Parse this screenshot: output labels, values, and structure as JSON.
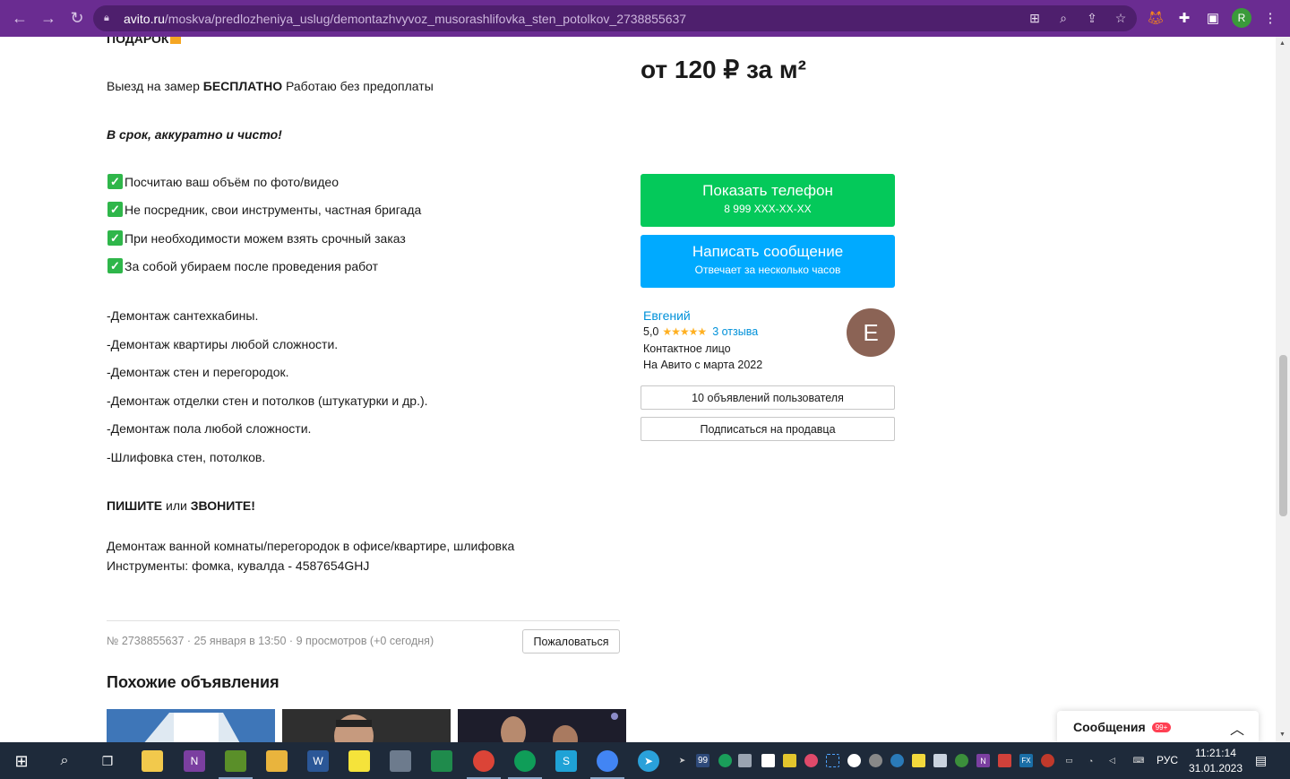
{
  "browser": {
    "url_host": "avito.ru",
    "url_path": "/moskva/predlozheniya_uslug/demontazhvyvoz_musorashlifovka_sten_potolkov_2738855637",
    "profile_initial": "R"
  },
  "description": {
    "gift_text": "ПОДАРОК",
    "visit_bold": "БЕСПЛАТНО",
    "visit_prefix": "Выезд на замер ",
    "visit_suffix": " Работаю без предоплаты",
    "slogan": "В срок, аккуратно и чисто!",
    "checks": [
      "Посчитаю ваш объём по фото/видео",
      "Не посредник, свои инструменты, частная бригада",
      "При необходимости можем взять срочный заказ",
      "За собой убираем после проведения работ"
    ],
    "services": [
      "-Демонтаж сантехкабины.",
      "-Демонтаж квартиры любой сложности.",
      "-Демонтаж стен и перегородок.",
      "-Демонтаж отделки стен и потолков (штукатурки и др.).",
      "-Демонтаж пола любой сложности.",
      "-Шлифовка стен, потолков."
    ],
    "cta_write": "ПИШИТЕ",
    "cta_or": " или ",
    "cta_call": "ЗВОНИТЕ!",
    "line1": "Демонтаж ванной комнаты/перегородок в офисе/квартире, шлифовка",
    "line2": "Инструменты: фомка, кувалда - 4587654GHJ"
  },
  "meta": {
    "info": "№ 2738855637 · 25 января в 13:50 · 9 просмотров (+0 сегодня)",
    "complain_label": "Пожаловаться"
  },
  "similar": {
    "title": "Похожие объявления"
  },
  "price": "от 120 ₽ за м²",
  "contact": {
    "phone_label": "Показать телефон",
    "phone_masked": "8 999 XXX-XX-XX",
    "message_label": "Написать сообщение",
    "message_sub": "Отвечает за несколько часов"
  },
  "seller": {
    "name": "Евгений",
    "rating": "5,0",
    "stars": "★★★★★",
    "reviews": "3 отзыва",
    "role": "Контактное лицо",
    "since": "На Авито с марта 2022",
    "avatar_initial": "Е",
    "listings_label": "10 объявлений пользователя",
    "subscribe_label": "Подписаться на продавца"
  },
  "messages": {
    "label": "Сообщения",
    "badge": "99+"
  },
  "taskbar": {
    "lang": "РУС",
    "time": "11:21:14",
    "date": "31.01.2023",
    "tray_badge": "99"
  },
  "colors": {
    "chrome": "#6a2c91",
    "green": "#04c95a",
    "blue": "#00aaff",
    "link": "#0091d9"
  }
}
